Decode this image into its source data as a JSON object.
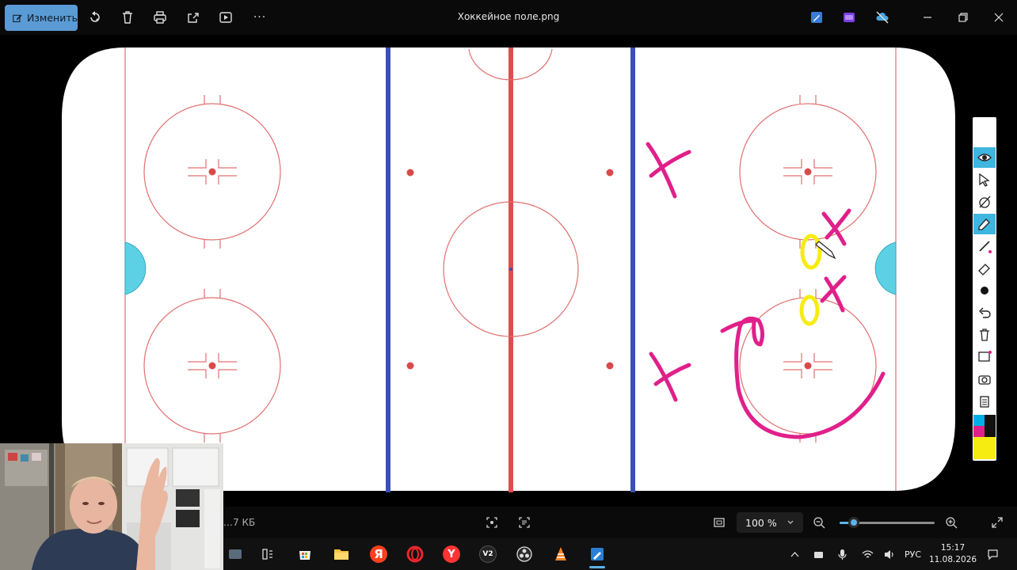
{
  "toolbar": {
    "edit_label": "Изменить",
    "more_label": "···"
  },
  "window": {
    "title": "Хоккейное поле.png"
  },
  "statusbar": {
    "file_size": "…7 КБ",
    "zoom_value": "100 %",
    "zoom_fraction": 0.15
  },
  "taskbar": {
    "language": "РУС",
    "time": "15:17",
    "date": "11.08.2026",
    "yandex_label": "Я",
    "v2_label": "V2",
    "y_label": "Y"
  },
  "colors": {
    "rink_red": "#e04d4d",
    "blue_line": "#3b4fb8",
    "goal_crease": "#5cd1e6",
    "annotation_pink": "#e0208a",
    "annotation_yellow": "#f6ec12",
    "accent": "#5b9bd5"
  },
  "draw_palette": [
    "#000000",
    "#00aee8",
    "#e0208a",
    "#f6ec12"
  ]
}
